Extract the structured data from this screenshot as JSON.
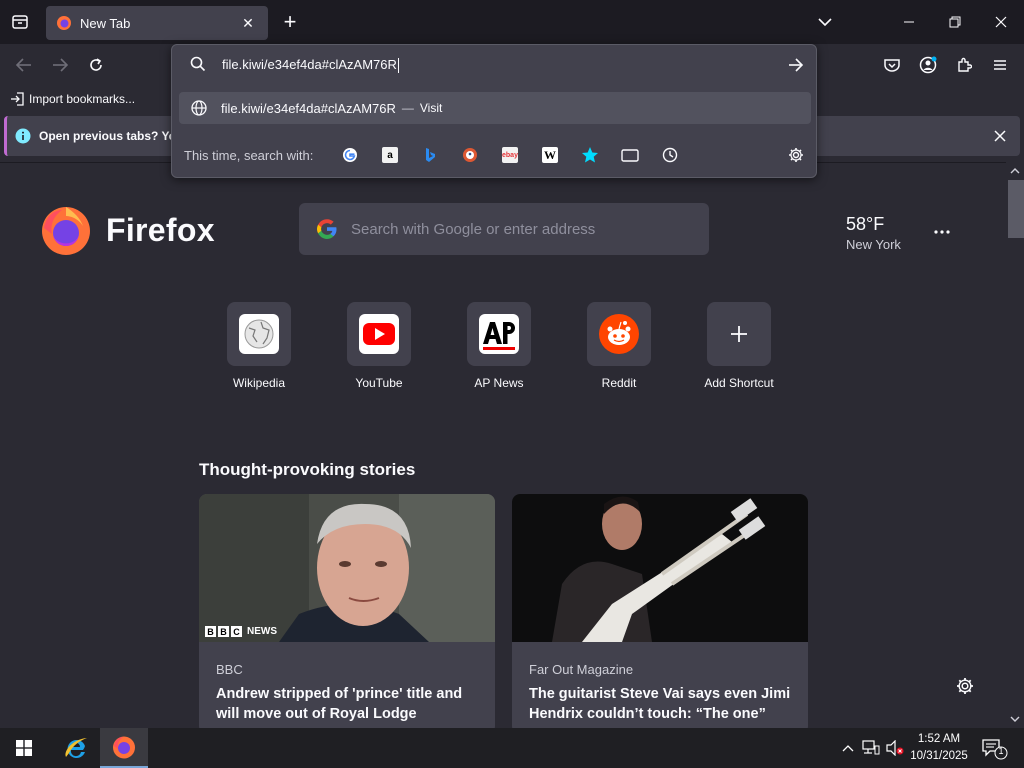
{
  "browser": {
    "tab_title": "New Tab",
    "tab_close": "✕",
    "new_tab": "+"
  },
  "bookmarks": {
    "import_label": "Import bookmarks..."
  },
  "notification": {
    "text": "Open previous tabs? You"
  },
  "urlbar": {
    "value": "file.kiwi/e34ef4da#clAzAM76R",
    "result_text": "file.kiwi/e34ef4da#clAzAM76R",
    "result_sep": "—",
    "result_action": "Visit",
    "search_with_label": "This time, search with:",
    "engines": [
      "google-icon",
      "amazon-icon",
      "bing-icon",
      "duckduckgo-icon",
      "ebay-icon",
      "wikipedia-icon",
      "bookmarks-star-icon",
      "tabs-icon",
      "history-icon"
    ]
  },
  "newtab": {
    "brand": "Firefox",
    "search_placeholder": "Search with Google or enter address",
    "weather_temp": "58°F",
    "weather_city": "New York",
    "shortcuts": [
      {
        "label": "Wikipedia"
      },
      {
        "label": "YouTube"
      },
      {
        "label": "AP News"
      },
      {
        "label": "Reddit"
      },
      {
        "label": "Add Shortcut"
      }
    ],
    "stories_title": "Thought-provoking stories",
    "stories": [
      {
        "source": "BBC",
        "headline": "Andrew stripped of 'prince' title and will move out of Royal Lodge",
        "badge": "NEWS"
      },
      {
        "source": "Far Out Magazine",
        "headline": "The guitarist Steve Vai says even Jimi Hendrix couldn’t touch: “The one”"
      }
    ]
  },
  "taskbar": {
    "time": "1:52 AM",
    "date": "10/31/2025",
    "notif_count": "1"
  },
  "colors": {
    "accent": "#c06bd1",
    "toolbar": "#2b2a33",
    "panel": "#42414d"
  }
}
